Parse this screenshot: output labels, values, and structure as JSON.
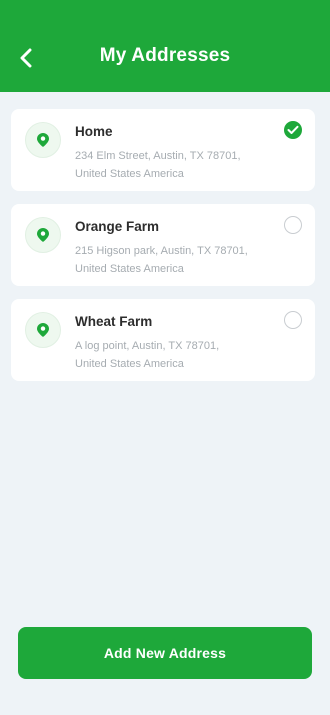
{
  "header": {
    "title": "My Addresses",
    "back_icon": "chevron-left-icon"
  },
  "addresses": [
    {
      "name": "Home",
      "line1": "234 Elm Street, Austin, TX 78701,",
      "line2": "United States America",
      "selected": true
    },
    {
      "name": "Orange Farm",
      "line1": "215 Higson park, Austin, TX 78701,",
      "line2": "United States America",
      "selected": false
    },
    {
      "name": "Wheat Farm",
      "line1": "A log point, Austin, TX 78701,",
      "line2": "United States America",
      "selected": false
    }
  ],
  "footer": {
    "add_label": "Add New Address"
  },
  "colors": {
    "primary": "#1ea83a",
    "background": "#eef3f7",
    "card": "#ffffff",
    "muted_text": "#a6acb1"
  },
  "icons": {
    "address": "location-pin-icon",
    "selected": "check-circle-icon",
    "unselected": "radio-empty-icon"
  }
}
